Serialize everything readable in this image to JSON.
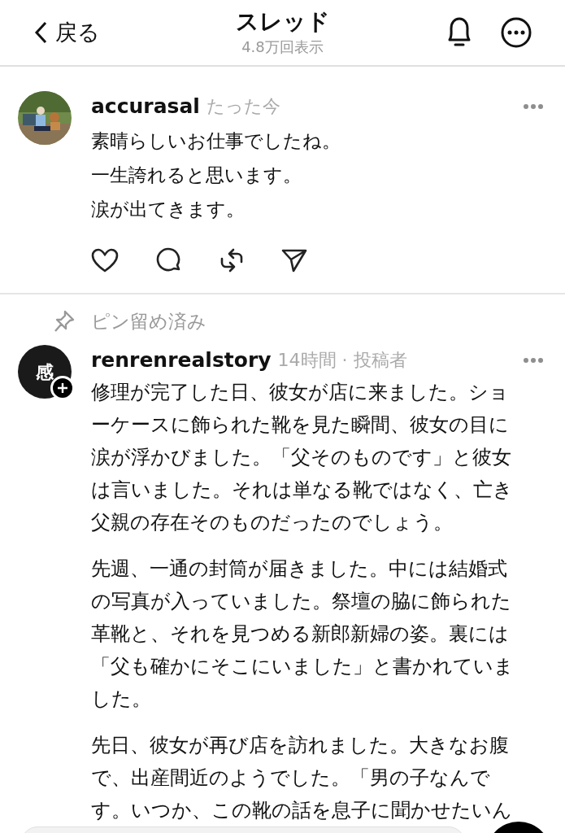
{
  "header": {
    "back_label": "戻る",
    "title": "スレッド",
    "subtitle": "4.8万回表示"
  },
  "comment": {
    "username": "accurasal",
    "time": "たった今",
    "lines": [
      "素晴らしいお仕事でしたね。",
      "一生誇れると思います。",
      "涙が出てきます。"
    ]
  },
  "pinned_label": "ピン留め済み",
  "post": {
    "username": "renrenrealstory",
    "meta": "14時間 · 投稿者",
    "avatar_text": "感",
    "follow": true,
    "paragraphs": [
      [
        "修理が完了した日、彼女が店に来ました。ショ",
        "ーケースに飾られた靴を見た瞬間、彼女の目に",
        "涙が浮かびました。「父そのものです」と彼女",
        "は言いました。それは単なる靴ではなく、亡き",
        "父親の存在そのものだったのでしょう。"
      ],
      [
        "先週、一通の封筒が届きました。中には結婚式",
        "の写真が入っていました。祭壇の脇に飾られた",
        "革靴と、それを見つめる新郎新婦の姿。裏には",
        "「父も確かにそこにいました」と書かれていま",
        "した。"
      ],
      [
        "先日、彼女が再び店を訪れました。大きなお腹",
        "で、出産間近のようでした。「男の子なんで",
        "す。いつか、この靴の話を息子に聞かせたいん"
      ]
    ]
  }
}
